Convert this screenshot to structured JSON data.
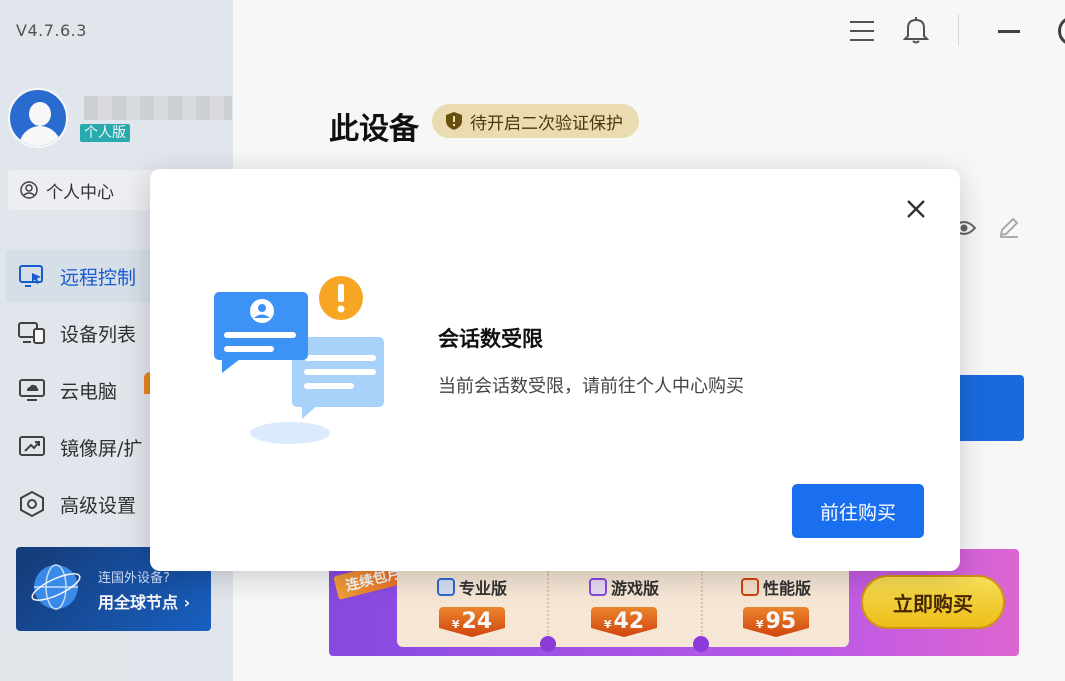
{
  "app": {
    "version": "V4.7.6.3"
  },
  "user": {
    "name": "",
    "plan_badge": "个人版"
  },
  "sidebar": {
    "personal_center": "个人中心",
    "items": [
      {
        "label": "远程控制",
        "icon": "remote-control-icon",
        "active": true
      },
      {
        "label": "设备列表",
        "icon": "device-list-icon",
        "active": false
      },
      {
        "label": "云电脑",
        "icon": "cloud-pc-icon",
        "active": false
      },
      {
        "label": "镜像屏/扩",
        "icon": "mirror-screen-icon",
        "active": false
      },
      {
        "label": "高级设置",
        "icon": "settings-icon",
        "active": false
      }
    ],
    "promo": {
      "line1": "连国外设备?",
      "line2": "用全球节点 ›"
    }
  },
  "main": {
    "title": "此设备",
    "verify_chip": "待开启二次验证保护"
  },
  "promo_banner": {
    "tag": "连续包月",
    "plans": [
      {
        "name": "专业版",
        "currency": "¥",
        "price": "24"
      },
      {
        "name": "游戏版",
        "currency": "¥",
        "price": "42"
      },
      {
        "name": "性能版",
        "currency": "¥",
        "price": "95"
      }
    ],
    "cta": "立即购买"
  },
  "dialog": {
    "title": "会话数受限",
    "message": "当前会话数受限，请前往个人中心购买",
    "button": "前往购买"
  },
  "colors": {
    "primary": "#1a6ef0",
    "sidebar_bg": "#e9eef4",
    "warning": "#f5a623"
  }
}
